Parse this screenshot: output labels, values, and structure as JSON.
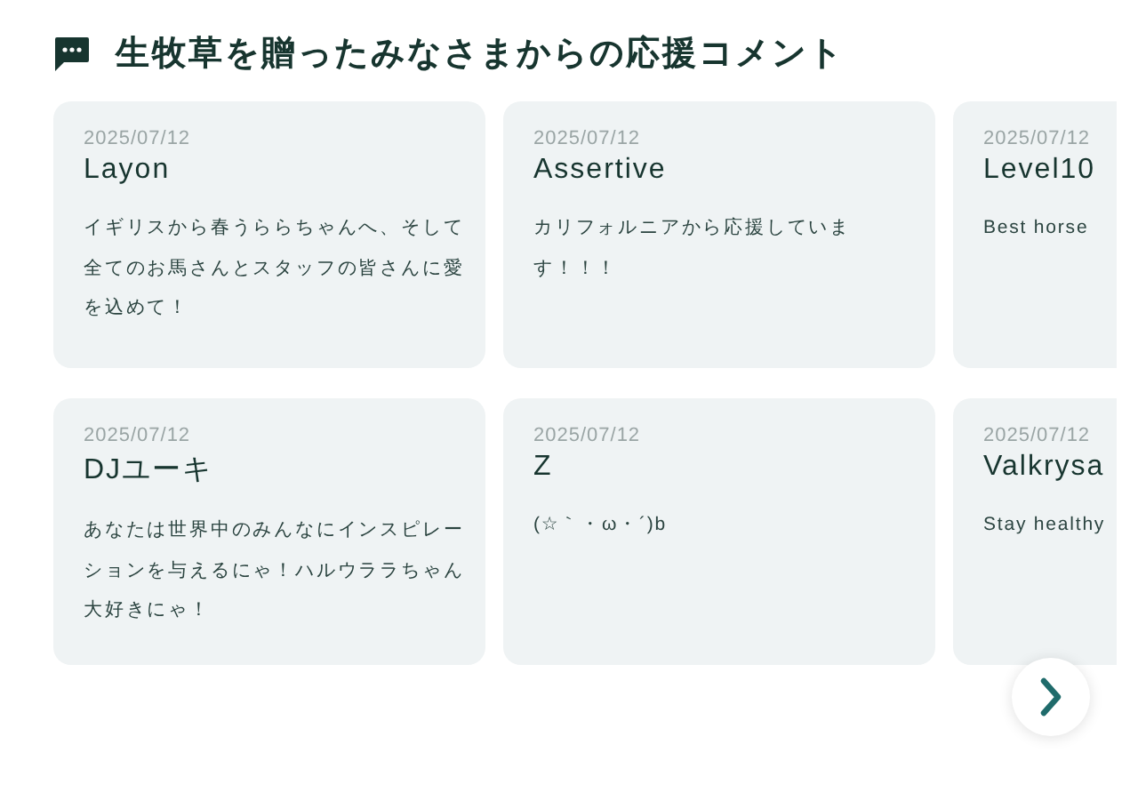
{
  "section": {
    "title": "生牧草を贈ったみなさまからの応援コメント"
  },
  "rows": [
    {
      "comments": [
        {
          "date": "2025/07/12",
          "name": "Layon",
          "text": "イギリスから春うららちゃんへ、そして全てのお馬さんとスタッフの皆さんに愛を込めて！"
        },
        {
          "date": "2025/07/12",
          "name": "Assertive",
          "text": "カリフォルニアから応援しています！！！"
        },
        {
          "date": "2025/07/12",
          "name": "Level10",
          "text": "Best horse"
        }
      ]
    },
    {
      "comments": [
        {
          "date": "2025/07/12",
          "name": "DJユーキ",
          "text": "あなたは世界中のみんなにインスピレーションを与えるにゃ！ハルウララちゃん大好きにゃ！"
        },
        {
          "date": "2025/07/12",
          "name": "Z",
          "text": "(☆｀・ω・´)b"
        },
        {
          "date": "2025/07/12",
          "name": "Valkrysa",
          "text": "Stay healthy"
        }
      ]
    }
  ]
}
